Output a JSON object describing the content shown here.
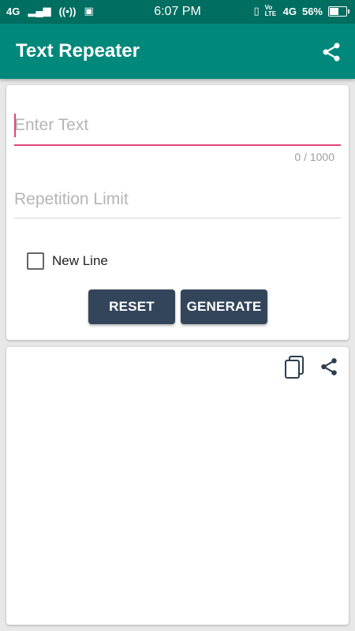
{
  "status_bar": {
    "network": "4G",
    "time": "6:07 PM",
    "network_right": "4G",
    "volte": "Vo LTE",
    "battery": "56%",
    "battery_level": 0.56
  },
  "app_bar": {
    "title": "Text Repeater",
    "share_icon": "share-icon"
  },
  "input_card": {
    "text_field": {
      "placeholder": "Enter Text",
      "value": ""
    },
    "counter": "0 / 1000",
    "repetition_field": {
      "placeholder": "Repetition Limit",
      "value": ""
    },
    "new_line_label": "New Line",
    "new_line_checked": false,
    "reset_label": "RESET",
    "generate_label": "GENERATE"
  },
  "output_card": {
    "copy_icon": "copy-icon",
    "share_icon": "share-icon",
    "output_text": ""
  },
  "colors": {
    "status_bar": "#006e60",
    "app_bar": "#00897b",
    "accent": "#e0457b",
    "button": "#33455a"
  }
}
